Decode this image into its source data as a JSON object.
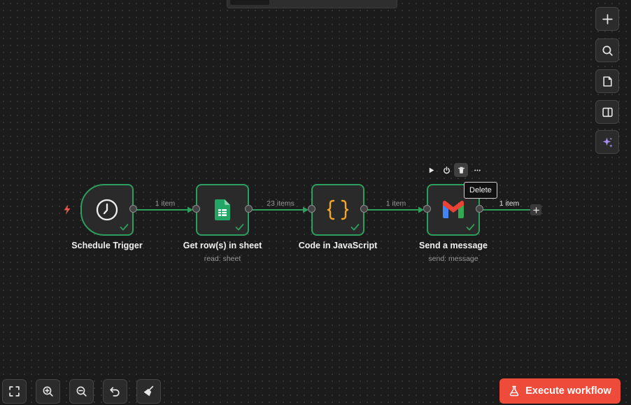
{
  "canvas": {
    "nodes": [
      {
        "title": "Schedule Trigger",
        "subtitle": "",
        "icon": "clock-icon"
      },
      {
        "title": "Get row(s) in sheet",
        "subtitle": "read: sheet",
        "icon": "google-sheets-icon"
      },
      {
        "title": "Code in JavaScript",
        "subtitle": "",
        "icon": "code-braces-icon"
      },
      {
        "title": "Send a message",
        "subtitle": "send: message",
        "icon": "gmail-icon"
      }
    ],
    "connections": [
      {
        "label": "1 item"
      },
      {
        "label": "23 items"
      },
      {
        "label": "1 item"
      },
      {
        "label": "1 item"
      }
    ],
    "node_toolbar": {
      "icons": [
        "play-icon",
        "power-icon",
        "trash-icon",
        "more-icon"
      ],
      "tooltip": "Delete"
    }
  },
  "right_toolbar": {
    "icons": [
      "plus-icon",
      "search-icon",
      "sticky-note-icon",
      "panel-icon",
      "ai-sparkle-icon"
    ]
  },
  "bottom_toolbar": {
    "icons": [
      "fit-view-icon",
      "zoom-in-icon",
      "zoom-out-icon",
      "undo-icon",
      "tidy-up-icon"
    ]
  },
  "execute_button": {
    "label": "Execute workflow"
  },
  "colors": {
    "success": "#2e9e5c",
    "accent_red": "#ef4b3a",
    "sparkle": "#a98cf0",
    "background": "#1b1b1b"
  }
}
